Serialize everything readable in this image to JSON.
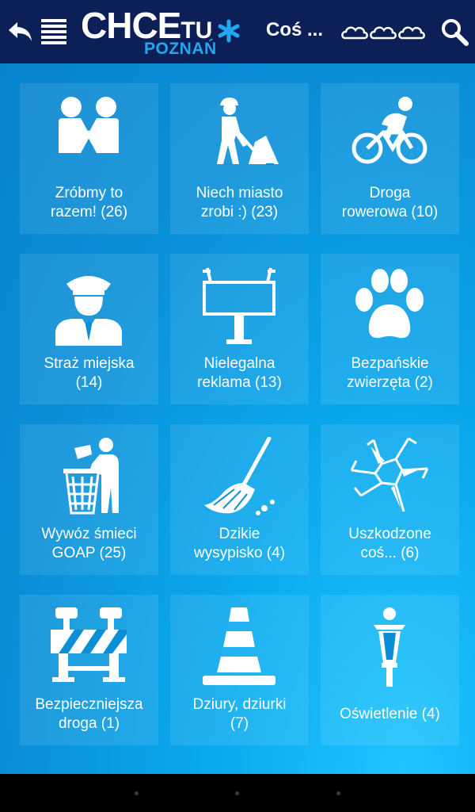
{
  "header": {
    "logo_main": "CHCE",
    "logo_tu": "TU",
    "logo_city": "POZNAŃ",
    "title": "Coś ...",
    "back_icon": "back-arrow-icon",
    "menu_icon": "hamburger-menu-icon",
    "status_icon": "cloud-icon",
    "search_icon": "search-icon"
  },
  "categories": [
    {
      "line1": "Zróbmy to",
      "line2": "razem! (26)",
      "icon": "people-handshake-icon"
    },
    {
      "line1": "Niech miasto",
      "line2": "zrobi :) (23)",
      "icon": "road-worker-icon"
    },
    {
      "line1": "Droga",
      "line2": "rowerowa (10)",
      "icon": "cyclist-icon"
    },
    {
      "line1": "Straż miejska",
      "line2": "(14)",
      "icon": "police-officer-icon"
    },
    {
      "line1": "Nielegalna",
      "line2": "reklama (13)",
      "icon": "billboard-icon"
    },
    {
      "line1": "Bezpańskie",
      "line2": "zwierzęta (2)",
      "icon": "paw-print-icon"
    },
    {
      "line1": "Wywóz śmieci",
      "line2": "GOAP (25)",
      "icon": "trash-disposal-icon"
    },
    {
      "line1": "Dzikie",
      "line2": "wysypisko (4)",
      "icon": "broom-icon"
    },
    {
      "line1": "Uszkodzone",
      "line2": "coś... (6)",
      "icon": "broken-glass-icon"
    },
    {
      "line1": "Bezpieczniejsza",
      "line2": "droga (1)",
      "icon": "road-barrier-icon"
    },
    {
      "line1": "Dziury, dziurki",
      "line2": "(7)",
      "icon": "traffic-cone-icon"
    },
    {
      "line1": "Oświetlenie (4)",
      "line2": "",
      "icon": "street-lamp-icon"
    }
  ],
  "colors": {
    "header_bg": "#0d1f57",
    "content_bg": "#0a9ae3",
    "accent": "#22a8f0",
    "text": "#ffffff"
  }
}
